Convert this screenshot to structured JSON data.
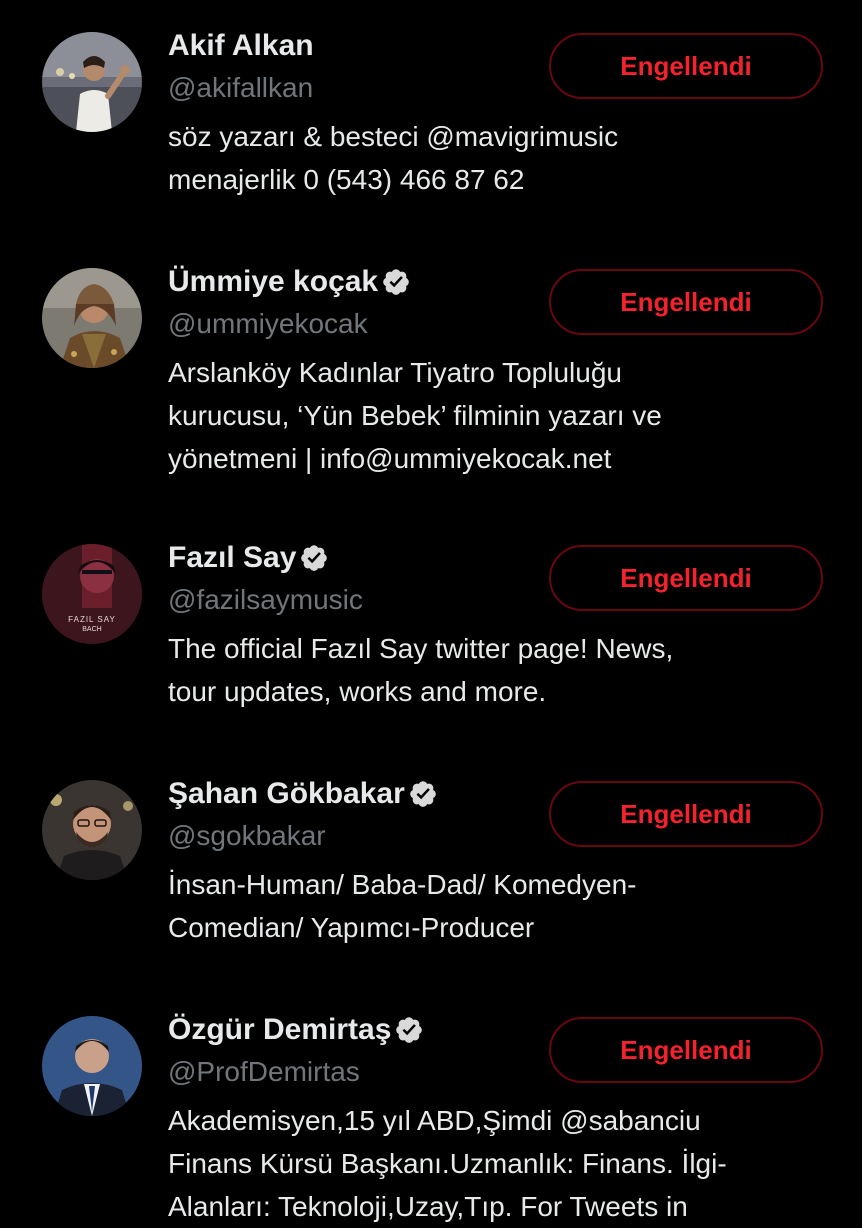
{
  "colors": {
    "background": "#000000",
    "name_text": "#e7e9ea",
    "handle_text": "#71767b",
    "blocked_button_text": "#f4212e",
    "blocked_button_border": "#67070f"
  },
  "users": [
    {
      "name": "Akif Alkan",
      "verified": false,
      "handle": "@akifallkan",
      "bio_lines": [
        "söz yazarı & besteci @mavigrimusic",
        "menajerlik 0 (543) 466 87 62"
      ],
      "button_label": "Engellendi"
    },
    {
      "name": "Ümmiye koçak",
      "verified": true,
      "handle": "@ummiyekocak",
      "bio_lines": [
        "Arslanköy Kadınlar Tiyatro Topluluğu",
        "kurucusu, ‘Yün Bebek’ filminin yazarı ve",
        "yönetmeni | info@ummiyekocak.net"
      ],
      "button_label": "Engellendi"
    },
    {
      "name": "Fazıl Say",
      "verified": true,
      "handle": "@fazilsaymusic",
      "bio_lines": [
        "The official Fazıl Say twitter page! News,",
        "tour updates, works and more."
      ],
      "button_label": "Engellendi",
      "avatar_text": [
        "FAZIL SAY",
        "BACH"
      ]
    },
    {
      "name": "Şahan Gökbakar",
      "verified": true,
      "handle": "@sgokbakar",
      "bio_lines": [
        "İnsan-Human/ Baba-Dad/ Komedyen-",
        "Comedian/ Yapımcı-Producer"
      ],
      "button_label": "Engellendi"
    },
    {
      "name": "Özgür Demirtaş",
      "verified": true,
      "handle": "@ProfDemirtas",
      "bio_lines": [
        "Akademisyen,15 yıl ABD,Şimdi @sabanciu",
        "Finans Kürsü Başkanı.Uzmanlık: Finans. İlgi-",
        "Alanları: Teknoloji,Uzay,Tıp. For Tweets in"
      ],
      "button_label": "Engellendi"
    }
  ]
}
